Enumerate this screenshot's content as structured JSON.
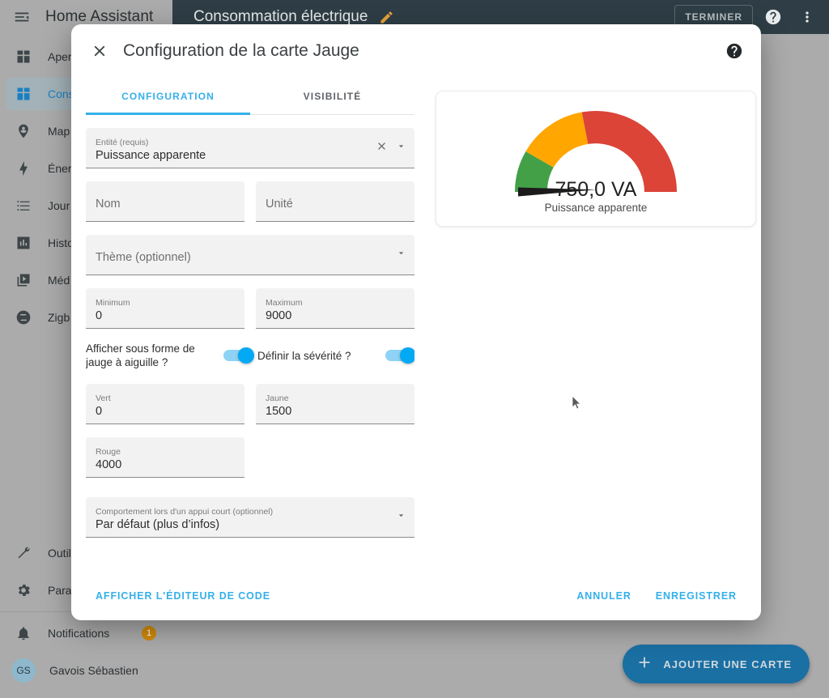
{
  "sidebar": {
    "app_title": "Home Assistant",
    "menu_icon": "menu-open-icon",
    "items": [
      {
        "label": "Aper",
        "icon": "view-dashboard-icon",
        "active": false
      },
      {
        "label": "Cons",
        "icon": "view-dashboard-icon",
        "active": true
      },
      {
        "label": "Map",
        "icon": "map-marker-account-icon",
        "active": false
      },
      {
        "label": "Éner",
        "icon": "lightning-bolt-icon",
        "active": false
      },
      {
        "label": "Jour",
        "icon": "format-list-bulleted-icon",
        "active": false
      },
      {
        "label": "Histo",
        "icon": "chart-box-icon",
        "active": false
      },
      {
        "label": "Méd",
        "icon": "play-box-multiple-icon",
        "active": false
      },
      {
        "label": "Zigb",
        "icon": "zigbee-icon",
        "active": false
      }
    ],
    "tools": [
      {
        "label": "Outil",
        "icon": "hammer-wrench-icon"
      },
      {
        "label": "Para",
        "icon": "cog-icon"
      }
    ],
    "notifications": {
      "label": "Notifications",
      "icon": "bell-icon",
      "badge": "1"
    },
    "user": {
      "name": "Gavois Sébastien",
      "initials": "GS"
    }
  },
  "topbar": {
    "title": "Consommation électrique",
    "edit_icon": "pencil-icon",
    "done_label": "TERMINER",
    "help_icon": "help-circle-icon",
    "overflow_icon": "dots-vertical-icon"
  },
  "page": {
    "fab_label": "AJOUTER UNE CARTE",
    "fab_icon": "plus-icon"
  },
  "dialog": {
    "close_icon": "close-icon",
    "title": "Configuration de la carte Jauge",
    "help_icon": "help-circle-icon",
    "tabs": [
      {
        "label": "CONFIGURATION",
        "active": true
      },
      {
        "label": "VISIBILITÉ",
        "active": false
      }
    ],
    "fields": {
      "entity": {
        "label": "Entité (requis)",
        "value": "Puissance apparente",
        "clear_icon": "close-icon",
        "dropdown_icon": "menu-down-icon"
      },
      "name": {
        "placeholder": "Nom",
        "value": ""
      },
      "unit": {
        "placeholder": "Unité",
        "value": ""
      },
      "theme": {
        "placeholder": "Thème (optionnel)",
        "value": "",
        "dropdown_icon": "menu-down-icon"
      },
      "minimum": {
        "label": "Minimum",
        "value": "0"
      },
      "maximum": {
        "label": "Maximum",
        "value": "9000"
      },
      "green": {
        "label": "Vert",
        "value": "0"
      },
      "yellow": {
        "label": "Jaune",
        "value": "1500"
      },
      "red": {
        "label": "Rouge",
        "value": "4000"
      },
      "tap_action": {
        "label": "Comportement lors d'un appui court (optionnel)",
        "value": "Par défaut (plus d’infos)",
        "dropdown_icon": "menu-down-icon"
      }
    },
    "toggles": {
      "needle": {
        "label": "Afficher sous forme de jauge à aiguille ?",
        "on": true
      },
      "severity": {
        "label": "Définir la sévérité ?",
        "on": true
      }
    },
    "footer": {
      "code_editor_label": "AFFICHER L'ÉDITEUR DE CODE",
      "cancel_label": "ANNULER",
      "save_label": "ENREGISTRER"
    }
  },
  "preview": {
    "value_text": "750,0 VA",
    "name": "Puissance apparente"
  },
  "chart_data": {
    "type": "gauge",
    "title": "Puissance apparente",
    "value": 750,
    "value_label": "750,0 VA",
    "unit": "VA",
    "min": 0,
    "max": 9000,
    "needle": true,
    "severity": true,
    "segments": [
      {
        "name": "Vert",
        "from": 0,
        "to": 1500,
        "color": "#43a047"
      },
      {
        "name": "Jaune",
        "from": 1500,
        "to": 4000,
        "color": "#ffa600"
      },
      {
        "name": "Rouge",
        "from": 4000,
        "to": 9000,
        "color": "#db4437"
      }
    ]
  },
  "colors": {
    "accent": "#35b0ea",
    "header_bg": "#2f3e46",
    "page_bg": "#ababab",
    "green": "#43a047",
    "yellow": "#ffa600",
    "red": "#db4437",
    "badge": "#d18b0a"
  }
}
